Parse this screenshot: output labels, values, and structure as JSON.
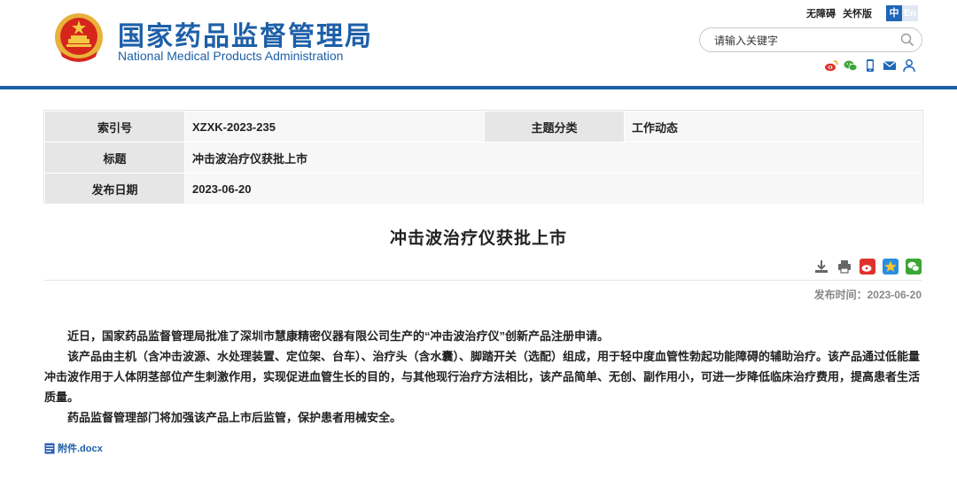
{
  "header": {
    "site_name_cn": "国家药品监督管理局",
    "site_name_en": "National Medical Products Administration",
    "top_links": {
      "accessibility": "无障碍",
      "elderly_mode": "关怀版"
    },
    "lang": {
      "zh": "中",
      "en": "En"
    },
    "search": {
      "placeholder": "请输入关键字"
    },
    "social_icons": [
      "weibo-icon",
      "wechat-icon",
      "mobile-icon",
      "mail-icon",
      "user-icon"
    ]
  },
  "info_table": {
    "index_label": "索引号",
    "index_value": "XZXK-2023-235",
    "category_label": "主题分类",
    "category_value": "工作动态",
    "title_label": "标题",
    "title_value": "冲击波治疗仪获批上市",
    "date_label": "发布日期",
    "date_value": "2023-06-20"
  },
  "article": {
    "title": "冲击波治疗仪获批上市",
    "publish_time": "发布时间：2023-06-20",
    "paragraphs": [
      "近日，国家药品监督管理局批准了深圳市慧康精密仪器有限公司生产的“冲击波治疗仪”创新产品注册申请。",
      "该产品由主机（含冲击波源、水处理装置、定位架、台车）、治疗头（含水囊）、脚踏开关（选配）组成，用于轻中度血管性勃起功能障碍的辅助治疗。该产品通过低能量冲击波作用于人体阴茎部位产生刺激作用，实现促进血管生长的目的，与其他现行治疗方法相比，该产品简单、无创、副作用小，可进一步降低临床治疗费用，提高患者生活质量。",
      "药品监督管理部门将加强该产品上市后监管，保护患者用械安全。"
    ],
    "attachment": "附件.docx",
    "tool_icons": [
      "download-icon",
      "print-icon",
      "weibo-share-icon",
      "qzone-share-icon",
      "wechat-share-icon"
    ]
  },
  "colors": {
    "brand_blue": "#1d5fa8",
    "label_bg": "#e6e6e6",
    "value_bg": "#f7f7f7"
  }
}
